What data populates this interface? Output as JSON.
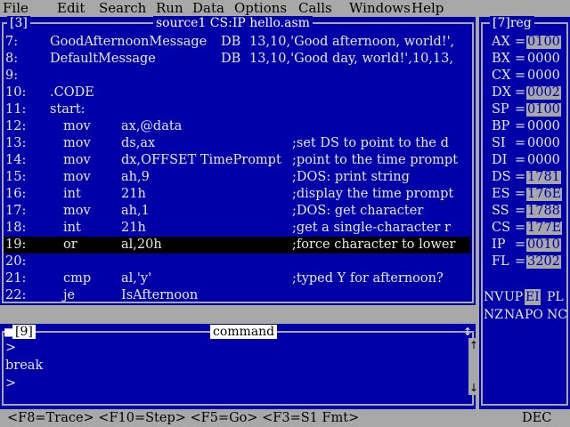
{
  "menu": [
    "File",
    "Edit",
    "Search",
    "Run",
    "Data",
    "Options",
    "Calls",
    "Windows",
    "Help"
  ],
  "source": {
    "pane_number": "[3]",
    "title": "source1 CS:IP hello.asm",
    "lines": [
      {
        "n": "7:",
        "a": "GoodAfternoonMessage",
        "b": "DB",
        "c": "13,10,'Good afternoon, world!',"
      },
      {
        "n": "8:",
        "a": "DefaultMessage",
        "b": "DB",
        "c": "13,10,'Good day, world!',10,13,"
      },
      {
        "n": "9:",
        "a": "",
        "b": "",
        "c": ""
      },
      {
        "n": "10:",
        "a": ".CODE",
        "b": "",
        "c": ""
      },
      {
        "n": "11:",
        "a": "start:",
        "b": "",
        "c": ""
      },
      {
        "n": "12:",
        "op": "mov",
        "arg": "ax,@data",
        "cm": ""
      },
      {
        "n": "13:",
        "op": "mov",
        "arg": "ds,ax",
        "cm": ";set DS to point to the d"
      },
      {
        "n": "14:",
        "op": "mov",
        "arg": "dx,OFFSET TimePrompt",
        "cm": ";point to the time prompt"
      },
      {
        "n": "15:",
        "op": "mov",
        "arg": "ah,9",
        "cm": ";DOS: print string"
      },
      {
        "n": "16:",
        "op": "int",
        "arg": "21h",
        "cm": ";display the time prompt"
      },
      {
        "n": "17:",
        "op": "mov",
        "arg": "ah,1",
        "cm": ";DOS: get character"
      },
      {
        "n": "18:",
        "op": "int",
        "arg": "21h",
        "cm": ";get a single-character r"
      },
      {
        "n": "19:",
        "op": "or",
        "arg": "al,20h",
        "cm": ";force character to lower"
      },
      {
        "n": "20:",
        "op": "",
        "arg": "",
        "cm": ""
      },
      {
        "n": "21:",
        "op": "cmp",
        "arg": "al,'y'",
        "cm": ";typed Y for afternoon?"
      },
      {
        "n": "22:",
        "op": "je",
        "arg": "IsAfternoon",
        "cm": ""
      }
    ]
  },
  "registers": {
    "title": "[7]reg",
    "items": [
      {
        "name": "AX",
        "value": "0100",
        "changed": true
      },
      {
        "name": "BX",
        "value": "0000",
        "changed": false
      },
      {
        "name": "CX",
        "value": "0000",
        "changed": false
      },
      {
        "name": "DX",
        "value": "0002",
        "changed": true
      },
      {
        "name": "SP",
        "value": "0100",
        "changed": true
      },
      {
        "name": "BP",
        "value": "0000",
        "changed": false
      },
      {
        "name": "SI",
        "value": "0000",
        "changed": false
      },
      {
        "name": "DI",
        "value": "0000",
        "changed": false
      },
      {
        "name": "DS",
        "value": "1781",
        "changed": true
      },
      {
        "name": "ES",
        "value": "176E",
        "changed": true
      },
      {
        "name": "SS",
        "value": "1788",
        "changed": true
      },
      {
        "name": "CS",
        "value": "177E",
        "changed": true
      },
      {
        "name": "IP",
        "value": "0010",
        "changed": true
      },
      {
        "name": "FL",
        "value": "3202",
        "changed": true
      }
    ],
    "flags_row1": [
      {
        "t": "NV",
        "hl": false
      },
      {
        "t": "UP",
        "hl": false
      },
      {
        "t": "EI",
        "hl": true
      },
      {
        "t": "PL",
        "hl": false
      }
    ],
    "flags_row2": [
      {
        "t": "NZ",
        "hl": false
      },
      {
        "t": "NA",
        "hl": false
      },
      {
        "t": "PO",
        "hl": false
      },
      {
        "t": "NC",
        "hl": false
      }
    ]
  },
  "command": {
    "pane_number": "[9]",
    "title": "command",
    "lines": [
      ">",
      "break",
      ">"
    ]
  },
  "status": {
    "keys": "<F8=Trace> <F10=Step> <F5=Go> <F3=S1 Fmt>",
    "mode": "DEC"
  }
}
